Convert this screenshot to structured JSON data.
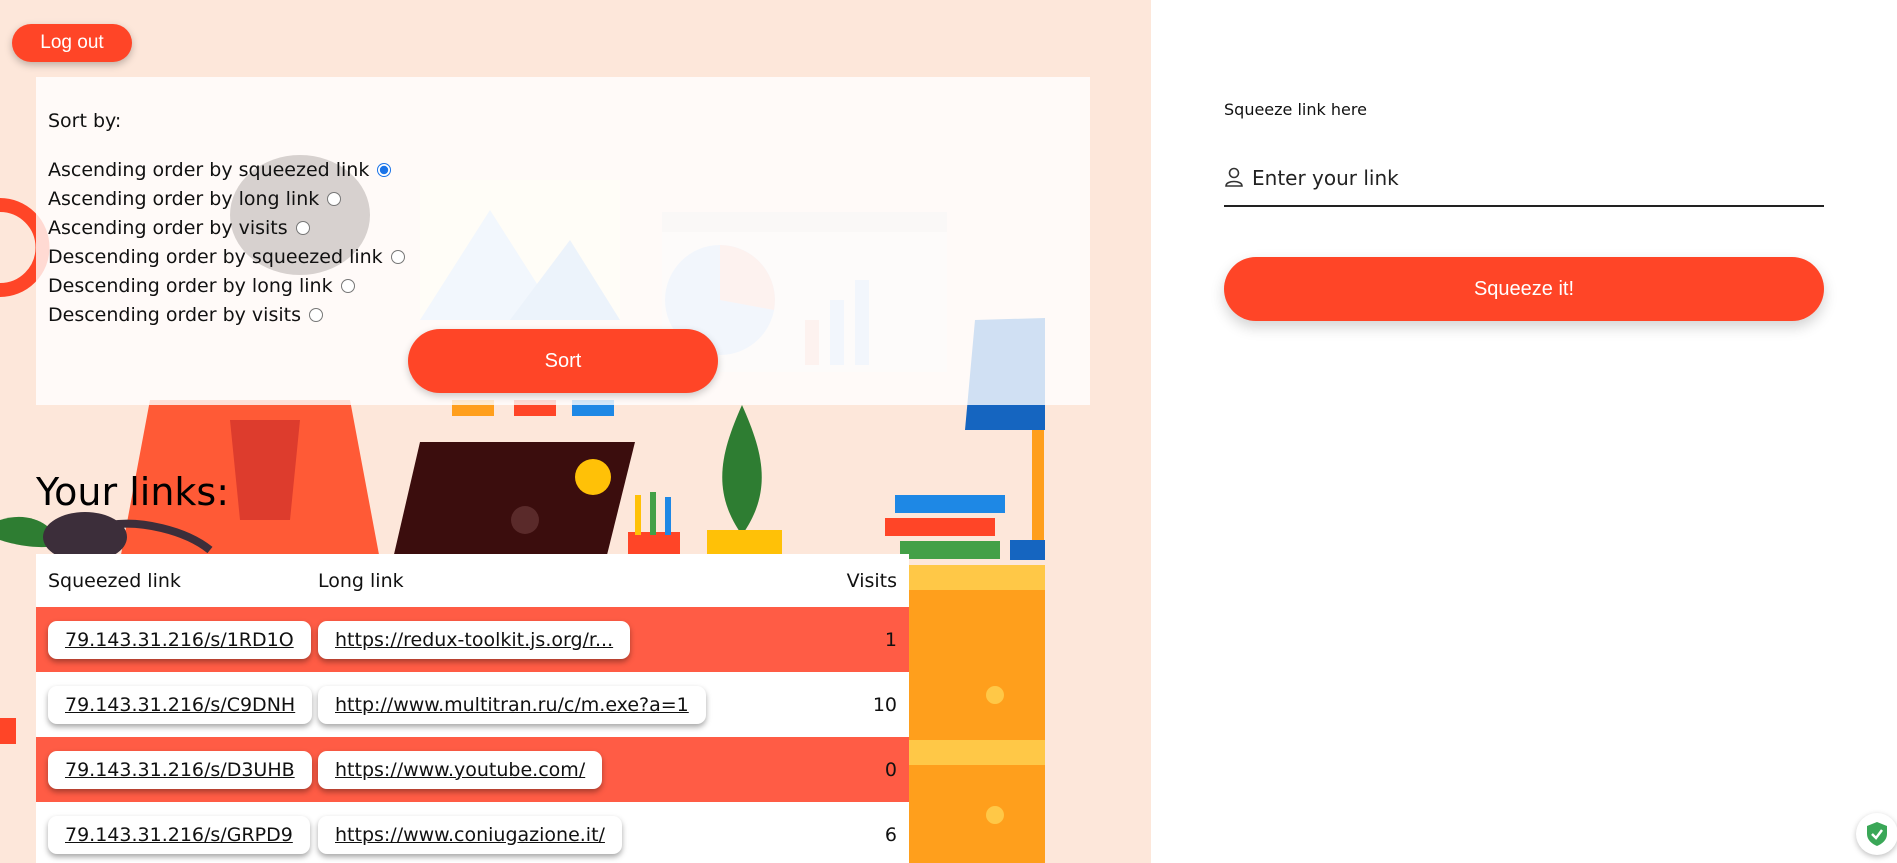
{
  "colors": {
    "accent": "#ff4527",
    "row_highlight": "#ff5c45",
    "left_bg": "#fde7da"
  },
  "header": {
    "logout_label": "Log out"
  },
  "sort": {
    "title": "Sort by:",
    "options": [
      {
        "label": "Ascending order by squeezed link",
        "checked": true
      },
      {
        "label": "Ascending order by long link",
        "checked": false
      },
      {
        "label": "Ascending order by visits",
        "checked": false
      },
      {
        "label": "Descending order by squeezed link",
        "checked": false
      },
      {
        "label": "Descending order by long link",
        "checked": false
      },
      {
        "label": "Descending order by visits",
        "checked": false
      }
    ],
    "button_label": "Sort"
  },
  "links": {
    "heading": "Your links:",
    "columns": {
      "squeezed": "Squeezed link",
      "long": "Long link",
      "visits": "Visits"
    },
    "rows": [
      {
        "squeezed": "79.143.31.216/s/1RD1O",
        "long": "https://redux-toolkit.js.org/r...",
        "visits": "1"
      },
      {
        "squeezed": "79.143.31.216/s/C9DNH",
        "long": "http://www.multitran.ru/c/m.exe?a=1",
        "visits": "10"
      },
      {
        "squeezed": "79.143.31.216/s/D3UHB",
        "long": "https://www.youtube.com/",
        "visits": "0"
      },
      {
        "squeezed": "79.143.31.216/s/GRPD9",
        "long": "https://www.coniugazione.it/",
        "visits": "6"
      }
    ]
  },
  "form": {
    "label": "Squeeze link here",
    "placeholder": "Enter your link",
    "button_label": "Squeeze it!"
  },
  "icons": {
    "user": "user-icon",
    "shield": "shield-check-icon"
  }
}
